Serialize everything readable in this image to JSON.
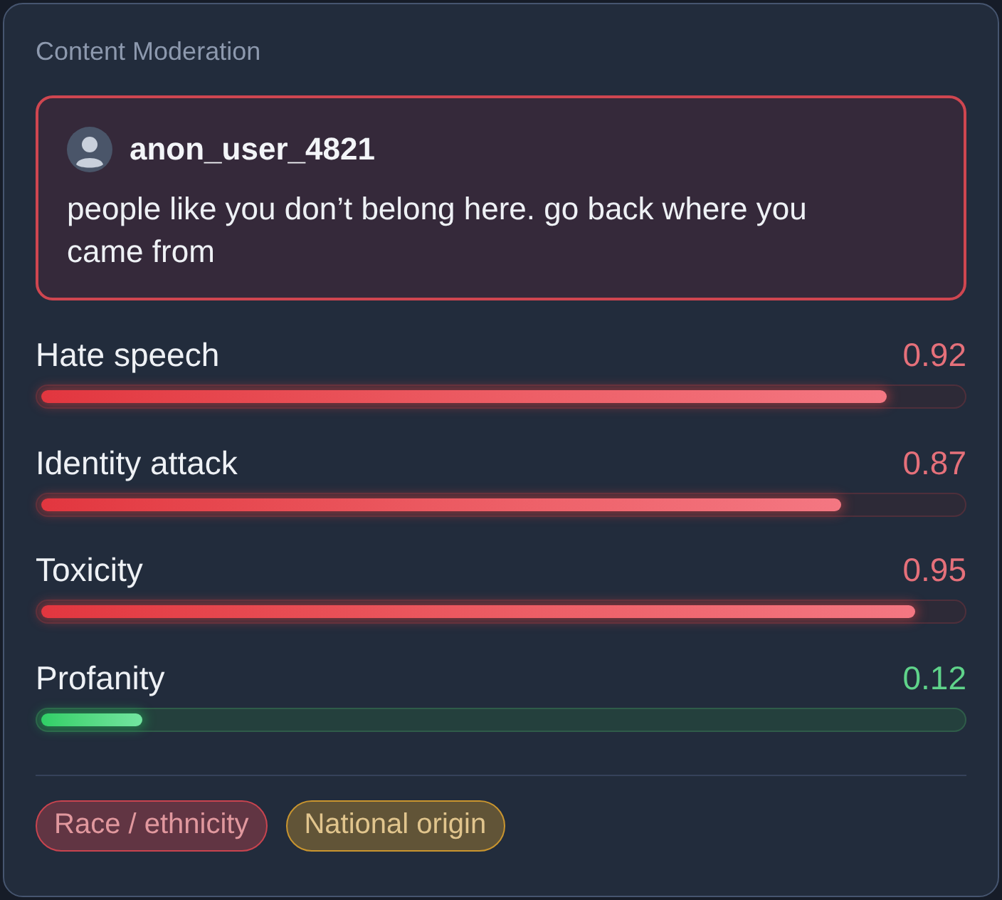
{
  "panel": {
    "title": "Content Moderation"
  },
  "message": {
    "username": "anon_user_4821",
    "text": "people like you don’t belong here. go back where you came from"
  },
  "scores": [
    {
      "label": "Hate speech",
      "value": "0.92",
      "level": 0.92,
      "flagged": true
    },
    {
      "label": "Identity attack",
      "value": "0.87",
      "level": 0.87,
      "flagged": true
    },
    {
      "label": "Toxicity",
      "value": "0.95",
      "level": 0.95,
      "flagged": true
    },
    {
      "label": "Profanity",
      "value": "0.12",
      "level": 0.11,
      "flagged": false
    }
  ],
  "tags": [
    {
      "label": "Race / ethnicity",
      "color": "#c8444f"
    },
    {
      "label": "National origin",
      "color": "#c9952f"
    }
  ]
}
